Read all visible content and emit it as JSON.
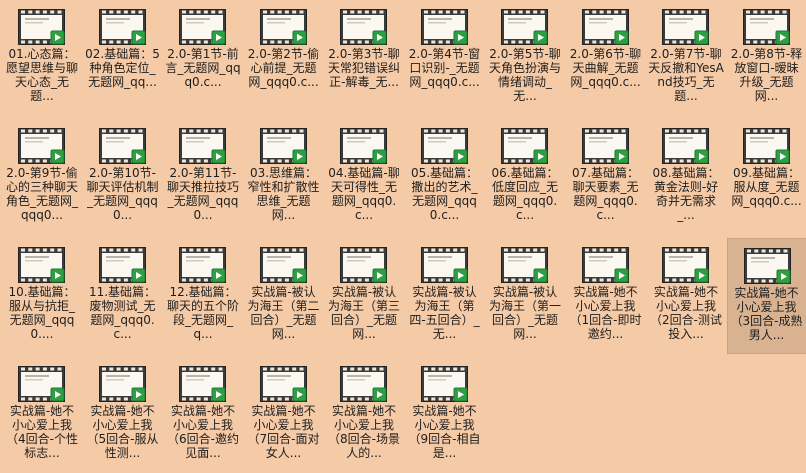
{
  "colors": {
    "background": "#f5caa6",
    "selected": "#d9b391",
    "badge": "#2ea043"
  },
  "icon": "video-file-icon",
  "files": [
    {
      "label": "01.心态篇：愿望思维与聊天心态_无题..."
    },
    {
      "label": "02.基础篇：5种角色定位_无题网_qq..."
    },
    {
      "label": "2.0-第1节-前言_无题网_qqq0.c..."
    },
    {
      "label": "2.0-第2节-偷心前提_无题网_qqq0.c..."
    },
    {
      "label": "2.0-第3节-聊天常犯错误纠正-解毒_无..."
    },
    {
      "label": "2.0-第4节-窗口识别-_无题网_qqq0.c..."
    },
    {
      "label": "2.0-第5节-聊天角色扮演与情绪调动_无..."
    },
    {
      "label": "2.0-第6节-聊天曲解_无题网_qqq0.c..."
    },
    {
      "label": "2.0-第7节-聊天反撤和YesAnd技巧_无题..."
    },
    {
      "label": "2.0-第8节-释放窗口-暧昧升级_无题网..."
    },
    {
      "label": "2.0-第9节-偷心的三种聊天角色_无题网_qqq0..."
    },
    {
      "label": "2.0-第10节-聊天评估机制_无题网_qqq0..."
    },
    {
      "label": "2.0-第11节-聊天推拉技巧_无题网_qqq0..."
    },
    {
      "label": "03.思维篇：窄性和扩散性思维_无题网..."
    },
    {
      "label": "04.基础篇-聊天可得性_无题网_qqq0.c..."
    },
    {
      "label": "05.基础篇：撒出的艺术_无题网_qqq0.c..."
    },
    {
      "label": "06.基础篇：低度回应_无题网_qqq0.c..."
    },
    {
      "label": "07.基础篇：聊天要素_无题网_qqq0.c..."
    },
    {
      "label": "08.基础篇：黄金法则-好奇并无需求_..."
    },
    {
      "label": "09.基础篇：服从度_无题网_qqq0.c..."
    },
    {
      "label": "10.基础篇：服从与抗拒_无题网_qqq0...."
    },
    {
      "label": "11.基础篇：废物测试_无题网_qqq0.c..."
    },
    {
      "label": "12.基础篇：聊天的五个阶段_无题网_q..."
    },
    {
      "label": "实战篇-被认为海王（第二回合）_无题网..."
    },
    {
      "label": "实战篇-被认为海王（第三回合）_无题网..."
    },
    {
      "label": "实战篇-被认为海王（第四-五回合）_无..."
    },
    {
      "label": "实战篇-被认为海王（第一回合）_无题网..."
    },
    {
      "label": "实战篇-她不小心爱上我（1回合-即时邀约..."
    },
    {
      "label": "实战篇-她不小心爱上我（2回合-测试投入..."
    },
    {
      "label": "实战篇-她不小心爱上我（3回合-成熟男人..."
    },
    {
      "label": "实战篇-她不小心爱上我（4回合-个性标志..."
    },
    {
      "label": "实战篇-她不小心爱上我（5回合-服从性测..."
    },
    {
      "label": "实战篇-她不小心爱上我（6回合-邀约见面..."
    },
    {
      "label": "实战篇-她不小心爱上我（7回合-面对女人..."
    },
    {
      "label": "实战篇-她不小心爱上我（8回合-场景人的..."
    },
    {
      "label": "实战篇-她不小心爱上我（9回合-相自是..."
    }
  ],
  "selected_index": 29
}
